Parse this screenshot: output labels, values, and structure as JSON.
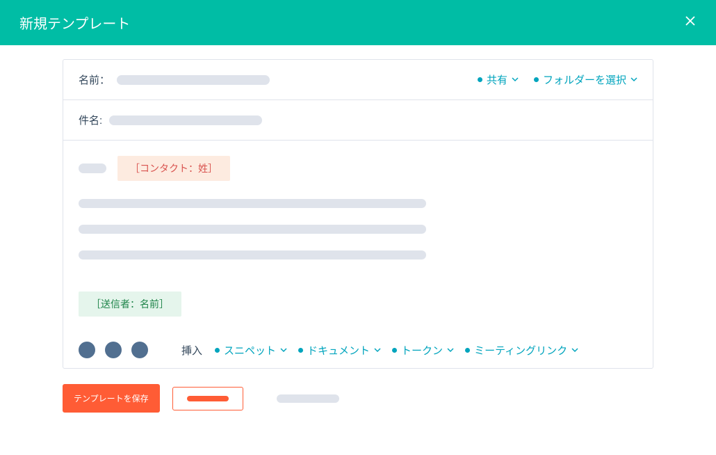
{
  "header": {
    "title": "新規テンプレート"
  },
  "fields": {
    "name_label": "名前：",
    "subject_label": "件名:"
  },
  "top_actions": {
    "share": "共有",
    "folder": "フォルダーを選択"
  },
  "body": {
    "token_contact_lastname": "［コンタクト：姓］",
    "token_sender_name": "［送信者：名前］"
  },
  "toolbar": {
    "insert_label": "挿入",
    "menus": {
      "snippet": "スニペット",
      "document": "ドキュメント",
      "token": "トークン",
      "meeting_link": "ミーティングリンク"
    }
  },
  "footer": {
    "save_label": "テンプレートを保存"
  }
}
